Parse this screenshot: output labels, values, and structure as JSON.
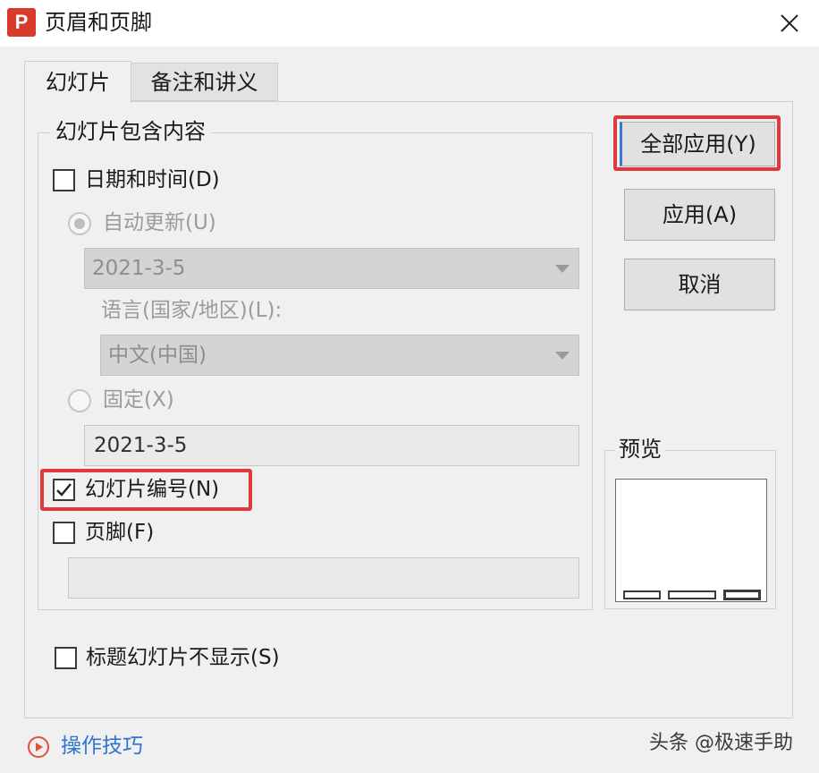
{
  "window": {
    "title": "页眉和页脚",
    "logo_letter": "P",
    "accent": "#d83b2a",
    "highlight_color": "#e0383c"
  },
  "tabs": [
    {
      "label": "幻灯片",
      "active": true
    },
    {
      "label": "备注和讲义",
      "active": false
    }
  ],
  "group": {
    "title": "幻灯片包含内容",
    "date_time": {
      "label": "日期和时间(D)",
      "checked": false
    },
    "auto_update": {
      "label": "自动更新(U)",
      "selected": true,
      "value": "2021-3-5"
    },
    "language": {
      "label": "语言(国家/地区)(L):",
      "value": "中文(中国)"
    },
    "fixed": {
      "label": "固定(X)",
      "selected": false,
      "value": "2021-3-5"
    },
    "slide_number": {
      "label": "幻灯片编号(N)",
      "checked": true
    },
    "footer": {
      "label": "页脚(F)",
      "checked": false,
      "value": ""
    }
  },
  "hide_on_title": {
    "label": "标题幻灯片不显示(S)",
    "checked": false
  },
  "buttons": {
    "apply_all": "全部应用(Y)",
    "apply": "应用(A)",
    "cancel": "取消"
  },
  "preview": {
    "title": "预览"
  },
  "footer_bar": {
    "tips_label": "操作技巧",
    "watermark": "头条 @极速手助"
  },
  "icons": {
    "close": "close-icon",
    "checkmark": "checkmark-icon",
    "dropdown": "chevron-down-icon",
    "play": "play-circle-icon"
  }
}
